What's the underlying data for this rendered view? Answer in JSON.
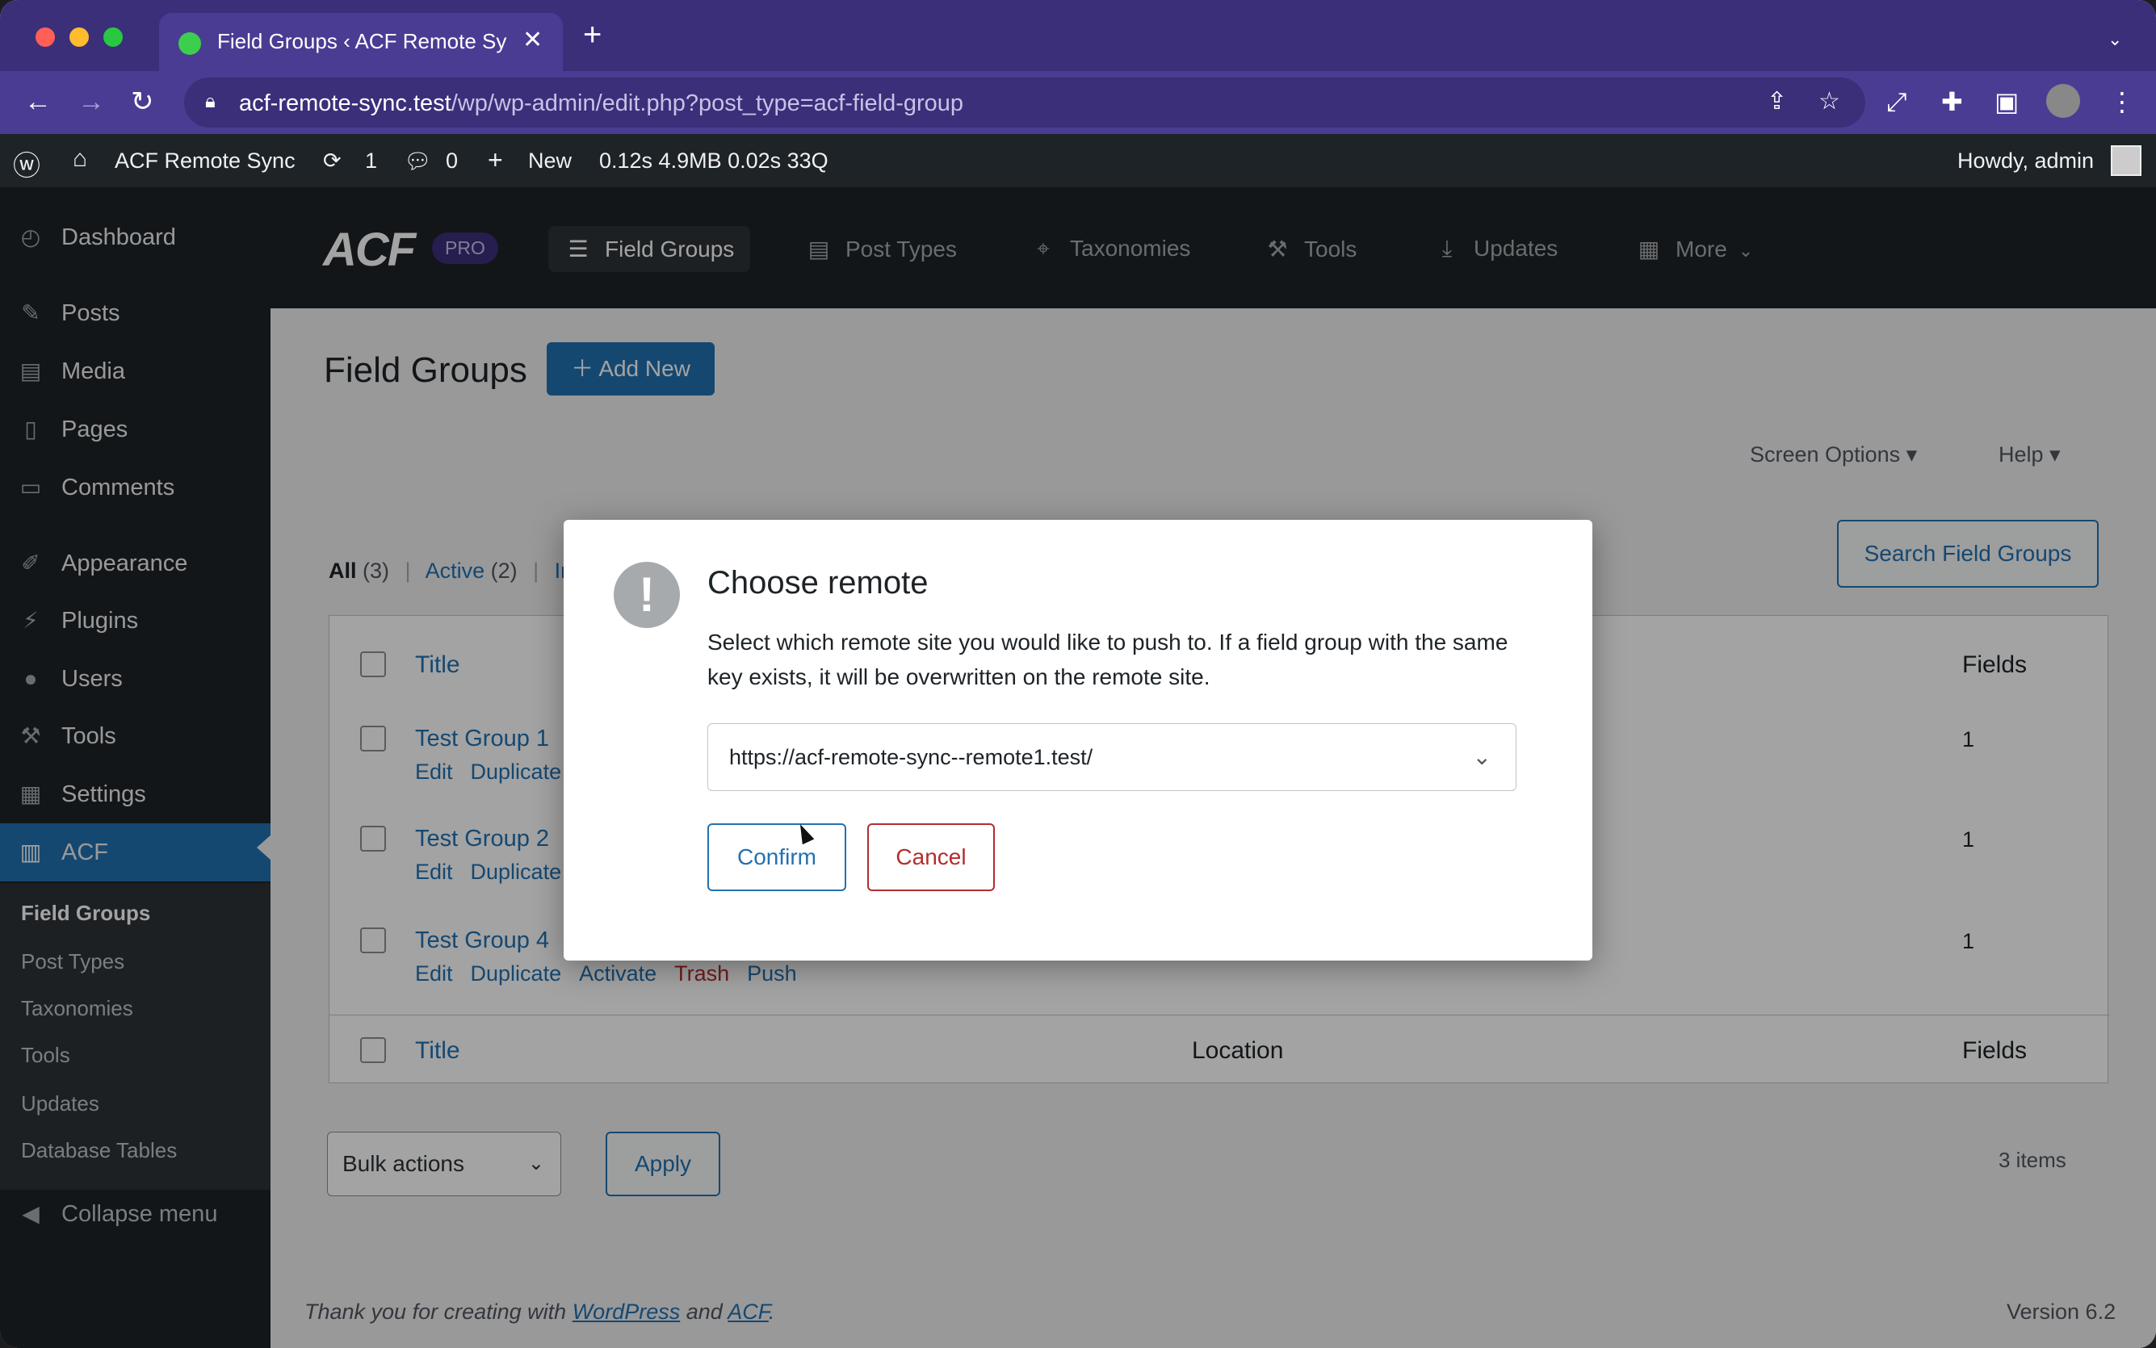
{
  "browser": {
    "tab_title": "Field Groups ‹ ACF Remote Sy",
    "url_host": "acf-remote-sync.test",
    "url_path": "/wp/wp-admin/edit.php?post_type=acf-field-group"
  },
  "adminbar": {
    "site_name": "ACF Remote Sync",
    "updates_count": "1",
    "comments_count": "0",
    "new_label": "New",
    "stats": "0.12s  4.9MB  0.02s  33Q",
    "howdy": "Howdy, admin"
  },
  "sidebar": {
    "items": [
      {
        "label": "Dashboard",
        "icon": "dashboard-icon"
      },
      {
        "label": "Posts",
        "icon": "pin-icon"
      },
      {
        "label": "Media",
        "icon": "media-icon"
      },
      {
        "label": "Pages",
        "icon": "page-icon"
      },
      {
        "label": "Comments",
        "icon": "comment-icon"
      },
      {
        "label": "Appearance",
        "icon": "brush-icon"
      },
      {
        "label": "Plugins",
        "icon": "plug-icon"
      },
      {
        "label": "Users",
        "icon": "user-icon"
      },
      {
        "label": "Tools",
        "icon": "wrench-icon"
      },
      {
        "label": "Settings",
        "icon": "settings-icon"
      },
      {
        "label": "ACF",
        "icon": "acf-icon"
      }
    ],
    "submenu": [
      "Field Groups",
      "Post Types",
      "Taxonomies",
      "Tools",
      "Updates",
      "Database Tables"
    ],
    "collapse": "Collapse menu"
  },
  "acf_header": {
    "logo": "ACF",
    "badge": "PRO",
    "nav": [
      "Field Groups",
      "Post Types",
      "Taxonomies",
      "Tools",
      "Updates",
      "More"
    ]
  },
  "page": {
    "title": "Field Groups",
    "add_new": "Add New",
    "screen_options": "Screen Options",
    "help": "Help",
    "filter_all": "All",
    "filter_all_count": "(3)",
    "filter_active": "Active",
    "filter_active_count": "(2)",
    "filter_in": "In",
    "search_button": "Search Field Groups",
    "columns": {
      "title": "Title",
      "location": "Location",
      "fields": "Fields"
    },
    "rows": [
      {
        "title": "Test Group 1",
        "actions": [
          "Edit",
          "Duplicate"
        ],
        "fields": "1"
      },
      {
        "title": "Test Group 2",
        "actions": [
          "Edit",
          "Duplicate"
        ],
        "fields": "1"
      },
      {
        "title": "Test Group 4",
        "actions": [
          "Edit",
          "Duplicate",
          "Activate",
          "Trash",
          "Push"
        ],
        "fields": "1"
      }
    ],
    "bulk_actions": "Bulk actions",
    "apply": "Apply",
    "items_count": "3 items",
    "footer_prefix": "Thank you for creating with",
    "footer_wp": "WordPress",
    "footer_and": "and",
    "footer_acf": "ACF",
    "version": "Version 6.2"
  },
  "modal": {
    "title": "Choose remote",
    "text": "Select which remote site you would like to push to. If a field group with the same key exists, it will be overwritten on the remote site.",
    "selected_remote": "https://acf-remote-sync--remote1.test/",
    "confirm": "Confirm",
    "cancel": "Cancel"
  }
}
